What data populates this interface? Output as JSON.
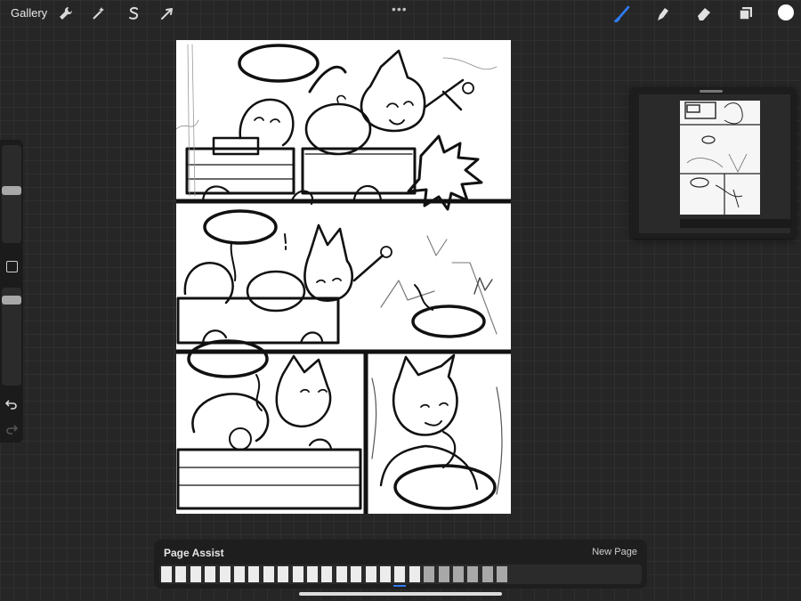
{
  "topbar": {
    "gallery_label": "Gallery",
    "more_label": "•••",
    "tools_left": [
      "wrench-icon",
      "magic-wand-icon",
      "selection-s-icon",
      "transform-arrow-icon"
    ],
    "tools_right": [
      "brush-icon",
      "smudge-icon",
      "eraser-icon",
      "layers-icon",
      "color-icon"
    ],
    "accent_color": "#2f7cf6",
    "active_color": "#ffffff"
  },
  "sidebar": {
    "brush_size_level": 0.45,
    "opacity_level": 0.1
  },
  "page_assist": {
    "title": "Page Assist",
    "new_page_label": "New Page",
    "page_count": 24,
    "selected_page": 17
  }
}
